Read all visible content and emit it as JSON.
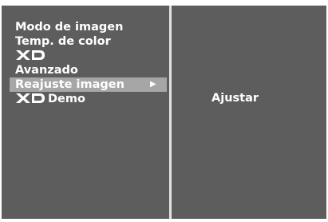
{
  "menu": {
    "items": [
      {
        "label": "Modo de imagen"
      },
      {
        "label": "Temp. de color"
      },
      {
        "label": "",
        "logo": "xd-logo"
      },
      {
        "label": "Avanzado"
      },
      {
        "label": "Reajuste imagen",
        "selected": true,
        "arrow_icon": "right-triangle-icon"
      },
      {
        "label": "Demo",
        "logo": "xd-logo"
      }
    ]
  },
  "submenu": {
    "option_label": "Ajustar"
  },
  "colors": {
    "panel_bg": "#5d5d5d",
    "selected_bg": "#a6a6a6",
    "divider": "#e3e3e3",
    "text": "#ffffff"
  }
}
